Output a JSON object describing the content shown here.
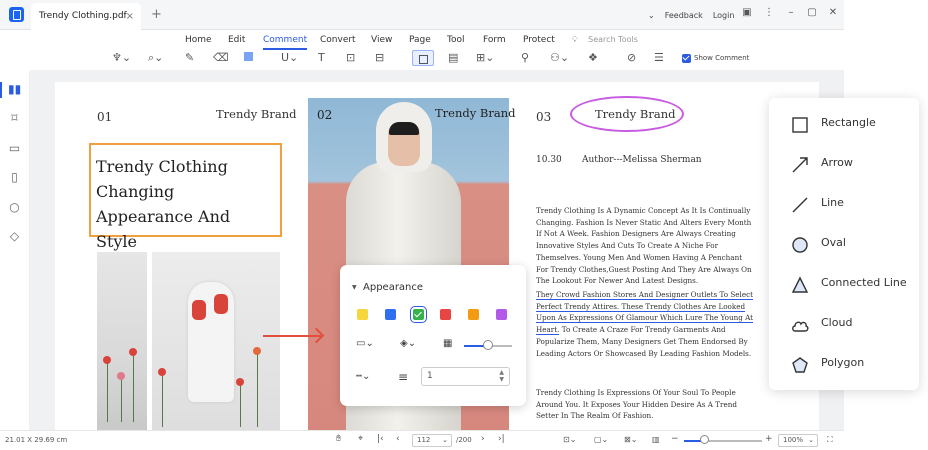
{
  "titlebar": {
    "tab_title": "Trendy Clothing.pdf",
    "tab_close": "×",
    "new_tab": "+",
    "feedback": "Feedback",
    "login": "Login"
  },
  "menu": {
    "items": [
      "Home",
      "Edit",
      "Comment",
      "Convert",
      "View",
      "Page",
      "Tool",
      "Form",
      "Protect"
    ],
    "active": "Comment",
    "search_placeholder": "Search Tools"
  },
  "toolbar": {
    "show_comment_label": "Show Comment",
    "show_comment_checked": true
  },
  "document": {
    "page1": {
      "number": "01",
      "brand": "Trendy Brand",
      "title": "Trendy Clothing Changing Appearance And Style"
    },
    "page2": {
      "number": "02",
      "brand": "Trendy Brand"
    },
    "page3": {
      "number": "03",
      "brand": "Trendy Brand",
      "date": "10.30",
      "author": "Author---Melissa Sherman",
      "para1": "Trendy Clothing Is A Dynamic Concept As It Is Continually Changing. Fashion Is Never Static And Alters Every Month If Not A Week. Fashion Designers Are Always Creating Innovative Styles And Cuts To Create A Niche For Themselves. Young Men And Women Having A Penchant For Trendy Clothes,Guest Posting And They Are Always On The Lookout For Newer And Latest Designs.",
      "para2_underlined": "They Crowd Fashion Stores And Designer Outlets To Select Perfect Trendy Attires. These Trendy Clothes Are Looked Upon As Expressions Of Glamour Which Lure The Young At Heart.",
      "para2_rest": " To Create A Craze For Trendy Garments And Popularize Them, Many Designers Get Them Endorsed By Leading Actors Or Showcased By Leading Fashion Models.",
      "para3": "Trendy Clothing Is Expressions Of Your Soul To People Around You. It Exposes Your Hidden Desire As A Trend Setter In The Realm Of Fashion."
    }
  },
  "appearance_panel": {
    "title": "Appearance",
    "colors": [
      "#f5d63d",
      "#2f6ef0",
      "#36b24a",
      "#e84545",
      "#f39c12",
      "#b35be8"
    ],
    "selected_color_index": 2,
    "opacity_percent": 50,
    "line_width": "1"
  },
  "shape_menu": {
    "items": [
      "Rectangle",
      "Arrow",
      "Line",
      "Oval",
      "Connected Line",
      "Cloud",
      "Polygon"
    ]
  },
  "statusbar": {
    "dimensions": "21.01 X 29.69 cm",
    "page_current": "112",
    "page_total": "/200",
    "zoom": "100%",
    "zoom_percent": 100
  },
  "colors": {
    "accent": "#2b5be0",
    "title_box_border": "#f0a03c",
    "annotation_oval": "#c85ce0",
    "annotation_arrow": "#e24d3c"
  }
}
